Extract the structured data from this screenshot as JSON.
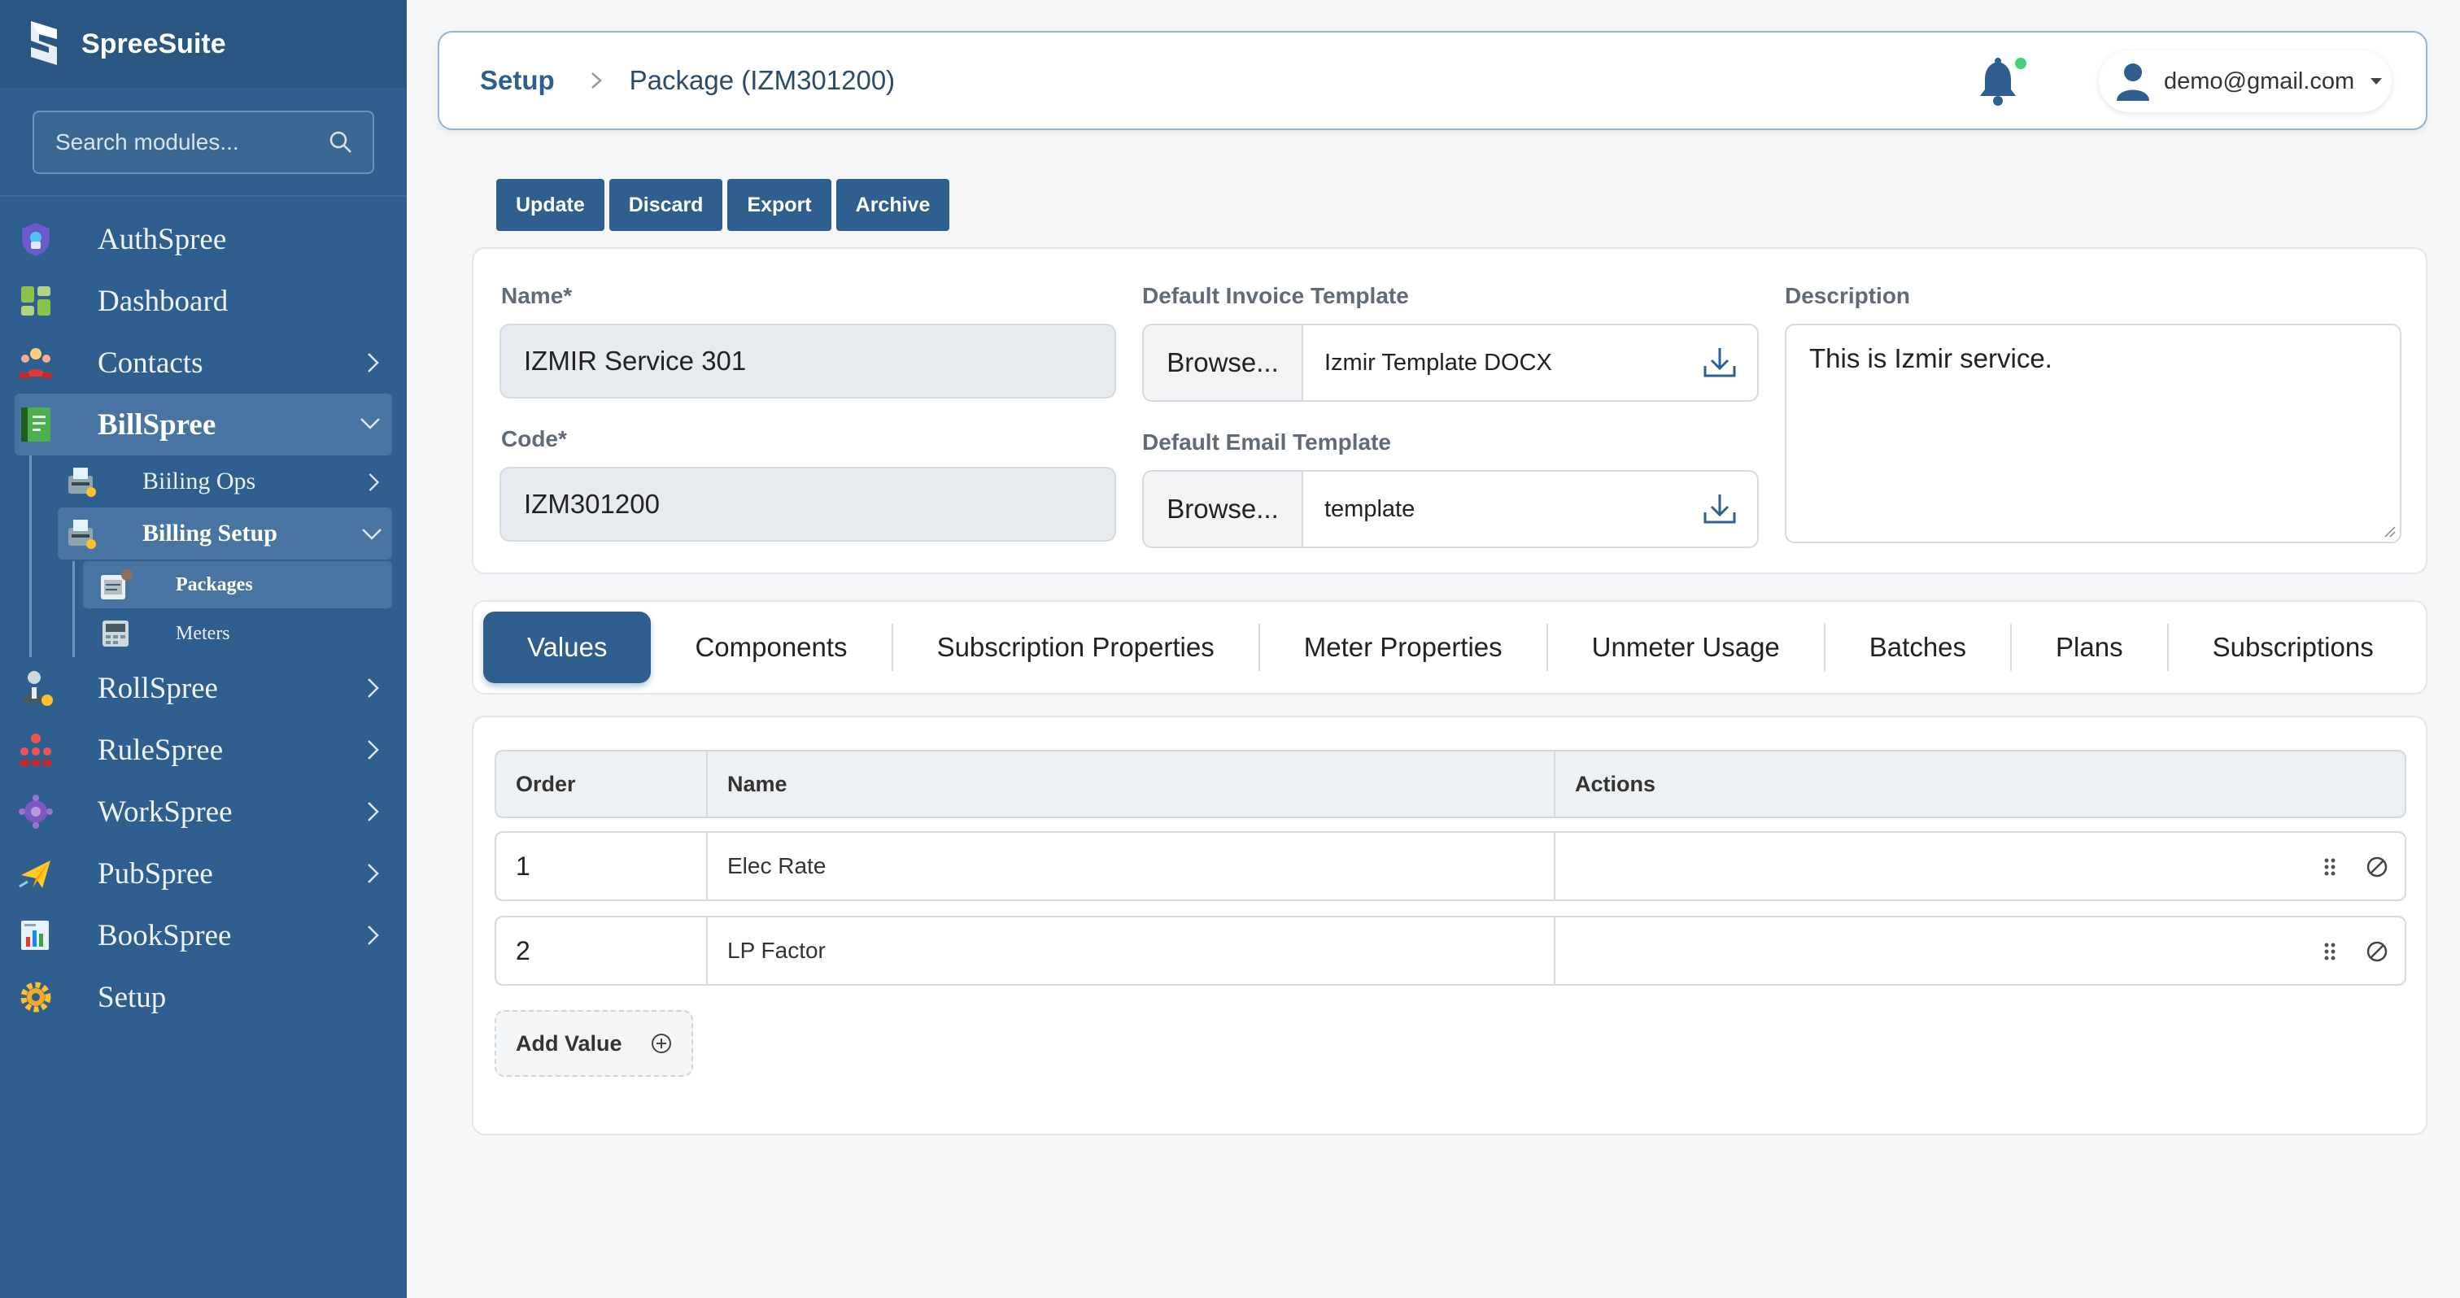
{
  "app": {
    "name": "SpreeSuite"
  },
  "search": {
    "placeholder": "Search modules..."
  },
  "sidebar": {
    "items": [
      {
        "label": "AuthSpree"
      },
      {
        "label": "Dashboard"
      },
      {
        "label": "Contacts"
      },
      {
        "label": "BillSpree"
      },
      {
        "label": "RollSpree"
      },
      {
        "label": "RuleSpree"
      },
      {
        "label": "WorkSpree"
      },
      {
        "label": "PubSpree"
      },
      {
        "label": "BookSpree"
      },
      {
        "label": "Setup"
      }
    ],
    "billspree_sub": [
      {
        "label": "Biiling Ops"
      },
      {
        "label": "Billing Setup"
      }
    ],
    "billing_setup_sub": [
      {
        "label": "Packages"
      },
      {
        "label": "Meters"
      }
    ]
  },
  "header": {
    "breadcrumb_root": "Setup",
    "breadcrumb_current": "Package (IZM301200)",
    "user_email": "demo@gmail.com",
    "notification_dot_color": "#44d17a"
  },
  "toolbar": {
    "update": "Update",
    "discard": "Discard",
    "export": "Export",
    "archive": "Archive"
  },
  "form": {
    "name_label": "Name*",
    "name_value": "IZMIR Service 301",
    "code_label": "Code*",
    "code_value": "IZM301200",
    "invoice_template_label": "Default Invoice Template",
    "invoice_browse": "Browse...",
    "invoice_file": "Izmir Template DOCX",
    "email_template_label": "Default Email Template",
    "email_browse": "Browse...",
    "email_file": "template",
    "description_label": "Description",
    "description_value": "This is Izmir service."
  },
  "tabs": [
    {
      "label": "Values"
    },
    {
      "label": "Components"
    },
    {
      "label": "Subscription Properties"
    },
    {
      "label": "Meter Properties"
    },
    {
      "label": "Unmeter Usage"
    },
    {
      "label": "Batches"
    },
    {
      "label": "Plans"
    },
    {
      "label": "Subscriptions"
    }
  ],
  "values_table": {
    "headers": {
      "order": "Order",
      "name": "Name",
      "actions": "Actions"
    },
    "rows": [
      {
        "order": "1",
        "name": "Elec Rate"
      },
      {
        "order": "2",
        "name": "LP Factor"
      }
    ],
    "add_label": "Add Value"
  },
  "colors": {
    "sidebar": "#2f5f8e",
    "accent": "#2f5f8e"
  }
}
